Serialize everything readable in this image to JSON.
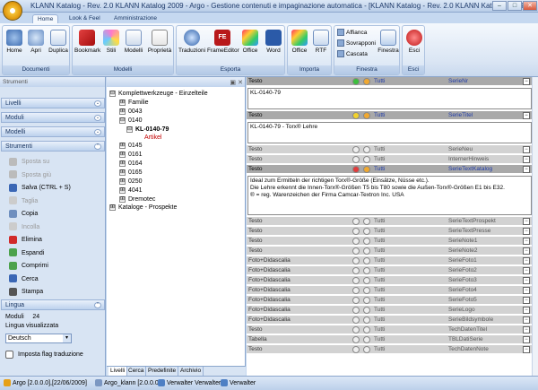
{
  "window": {
    "title": "KLANN Katalog - Rev. 2.0 KLANN Katalog 2009 - Argo - Gestione contenuti e impaginazione automatica - [KLANN Katalog - Rev. 2.0 KLANN Katalog 2009 ...",
    "logo_text": "argo",
    "min": "–",
    "max": "□",
    "close": "✕"
  },
  "tabs": [
    "Home",
    "Look & Feel",
    "Amministrazione"
  ],
  "ribbon": {
    "documenti": {
      "title": "Documenti",
      "buttons": [
        "Home",
        "Apri",
        "Duplica"
      ]
    },
    "modelli": {
      "title": "Modelli",
      "buttons": [
        "Bookmark",
        "Stili",
        "Modelli",
        "Proprietà"
      ]
    },
    "esporta": {
      "title": "Esporta",
      "buttons": [
        "Traduzioni",
        "FrameEditor",
        "Office",
        "Word"
      ]
    },
    "importa": {
      "title": "Importa",
      "buttons": [
        "Office",
        "RTF"
      ]
    },
    "finestra": {
      "title": "Finestra",
      "buttons": [
        "Affianca",
        "Sovrapponi",
        "Cascata",
        "Finestra"
      ]
    },
    "esci": {
      "title": "Esci",
      "buttons": [
        "Esci"
      ]
    }
  },
  "left": {
    "header": "Strumenti",
    "sections": [
      "Livelli",
      "Moduli",
      "Modelli",
      "Strumenti"
    ],
    "tools": [
      {
        "label": "Sposta su",
        "disabled": true
      },
      {
        "label": "Sposta giù",
        "disabled": true
      },
      {
        "label": "Salva    (CTRL + S)",
        "disabled": false
      },
      {
        "label": "Taglia",
        "disabled": true
      },
      {
        "label": "Copia",
        "disabled": false
      },
      {
        "label": "Incolla",
        "disabled": true
      },
      {
        "label": "Elimina",
        "disabled": false
      },
      {
        "label": "Espandi",
        "disabled": false
      },
      {
        "label": "Comprimi",
        "disabled": false
      },
      {
        "label": "Cerca",
        "disabled": false
      },
      {
        "label": "Stampa",
        "disabled": false
      }
    ],
    "lingua": {
      "header": "Lingua",
      "moduli_label": "Moduli",
      "moduli_value": "24",
      "lang_label": "Lingua visualizzata",
      "lang_value": "Deutsch",
      "checkbox": "Imposta flag traduzione"
    }
  },
  "tree": {
    "nodes": [
      {
        "label": "Komplettwerkzeuge - Einzelteile",
        "box": "⊟"
      },
      {
        "label": "Familie",
        "box": "⊞"
      },
      {
        "label": "0043",
        "box": "⊞"
      },
      {
        "label": "0140",
        "box": "⊟"
      },
      {
        "label": "KL-0140-79",
        "box": "⊟"
      },
      {
        "label": "Artikel",
        "box": ""
      },
      {
        "label": "0145",
        "box": "⊞"
      },
      {
        "label": "0161",
        "box": "⊞"
      },
      {
        "label": "0164",
        "box": "⊞"
      },
      {
        "label": "0165",
        "box": "⊞"
      },
      {
        "label": "0250",
        "box": "⊞"
      },
      {
        "label": "4041",
        "box": "⊞"
      },
      {
        "label": "Dremotec",
        "box": "⊞"
      },
      {
        "label": "Kataloge - Prospekte",
        "box": "⊞"
      }
    ],
    "tabs": [
      "Livelli",
      "Cerca",
      "Predefinite",
      "Archivio"
    ]
  },
  "grid": {
    "rows": [
      {
        "type": "Testo",
        "lang": "Tutti",
        "field": "SerieNr",
        "style": "hdr",
        "mark": "green"
      },
      {
        "text": "KL-0140-79"
      },
      {
        "type": "Testo",
        "lang": "Tutti",
        "field": "SerieTitel",
        "style": "hdr",
        "mark": "yellow"
      },
      {
        "text": "KL-0140-79 - Torx® Lehre"
      },
      {
        "type": "Testo",
        "lang": "Tutti",
        "field": "SerieNeu",
        "style": "dim",
        "mark": "none"
      },
      {
        "type": "Testo",
        "lang": "Tutti",
        "field": "InternerHinweis",
        "style": "dim",
        "mark": "none"
      },
      {
        "type": "Testo",
        "lang": "Tutti",
        "field": "SerieTextKatalog",
        "style": "hdr",
        "mark": "red"
      },
      {
        "text": "Ideal zum Ermitteln der richtigen Torx®-Größe (Einsätze, Nüsse etc.).\nDie Lehre erkennt die Innen-Torx®-Größen T5 bis T80 sowie die Außen-Torx®-Größen E1 bis E32.\n® = reg. Warenzeichen der Firma Camcar-Textron Inc. USA"
      },
      {
        "type": "Testo",
        "lang": "Tutti",
        "field": "SerieTextProspekt",
        "style": "dim",
        "mark": "none"
      },
      {
        "type": "Testo",
        "lang": "Tutti",
        "field": "SerieTextPresse",
        "style": "dim",
        "mark": "none"
      },
      {
        "type": "Testo",
        "lang": "Tutti",
        "field": "SerieNote1",
        "style": "dim",
        "mark": "none"
      },
      {
        "type": "Testo",
        "lang": "Tutti",
        "field": "SerieNote2",
        "style": "dim",
        "mark": "none"
      },
      {
        "type": "Foto+Didascalia",
        "lang": "Tutti",
        "field": "SerieFoto1",
        "style": "dim",
        "mark": "none"
      },
      {
        "type": "Foto+Didascalia",
        "lang": "Tutti",
        "field": "SerieFoto2",
        "style": "dim",
        "mark": "none"
      },
      {
        "type": "Foto+Didascalia",
        "lang": "Tutti",
        "field": "SerieFoto3",
        "style": "dim",
        "mark": "none"
      },
      {
        "type": "Foto+Didascalia",
        "lang": "Tutti",
        "field": "SerieFoto4",
        "style": "dim",
        "mark": "none"
      },
      {
        "type": "Foto+Didascalia",
        "lang": "Tutti",
        "field": "SerieFoto5",
        "style": "dim",
        "mark": "none"
      },
      {
        "type": "Foto+Didascalia",
        "lang": "Tutti",
        "field": "SerieLogo",
        "style": "dim",
        "mark": "none"
      },
      {
        "type": "Foto+Didascalia",
        "lang": "Tutti",
        "field": "SerieBildsymbole",
        "style": "dim",
        "mark": "none"
      },
      {
        "type": "Testo",
        "lang": "Tutti",
        "field": "TechDatenTitel",
        "style": "dim",
        "mark": "none"
      },
      {
        "type": "Tabella",
        "lang": "Tutti",
        "field": "TBLDatiSerie",
        "style": "dim",
        "mark": "none"
      },
      {
        "type": "Testo",
        "lang": "Tutti",
        "field": "TechDatenNote",
        "style": "dim",
        "mark": "none"
      }
    ]
  },
  "status": {
    "app": "Argo [2.0.0.0],[22/06/2009]",
    "db": "Argo_klann [2.0.0.0]",
    "user": "Verwalter Verwalter",
    "role": "Verwalter"
  },
  "colors": {
    "accent": "#15325f",
    "link": "#1e3aa8",
    "grid_dark": "#a9a9a9",
    "grid_light": "#d2d2d2"
  }
}
